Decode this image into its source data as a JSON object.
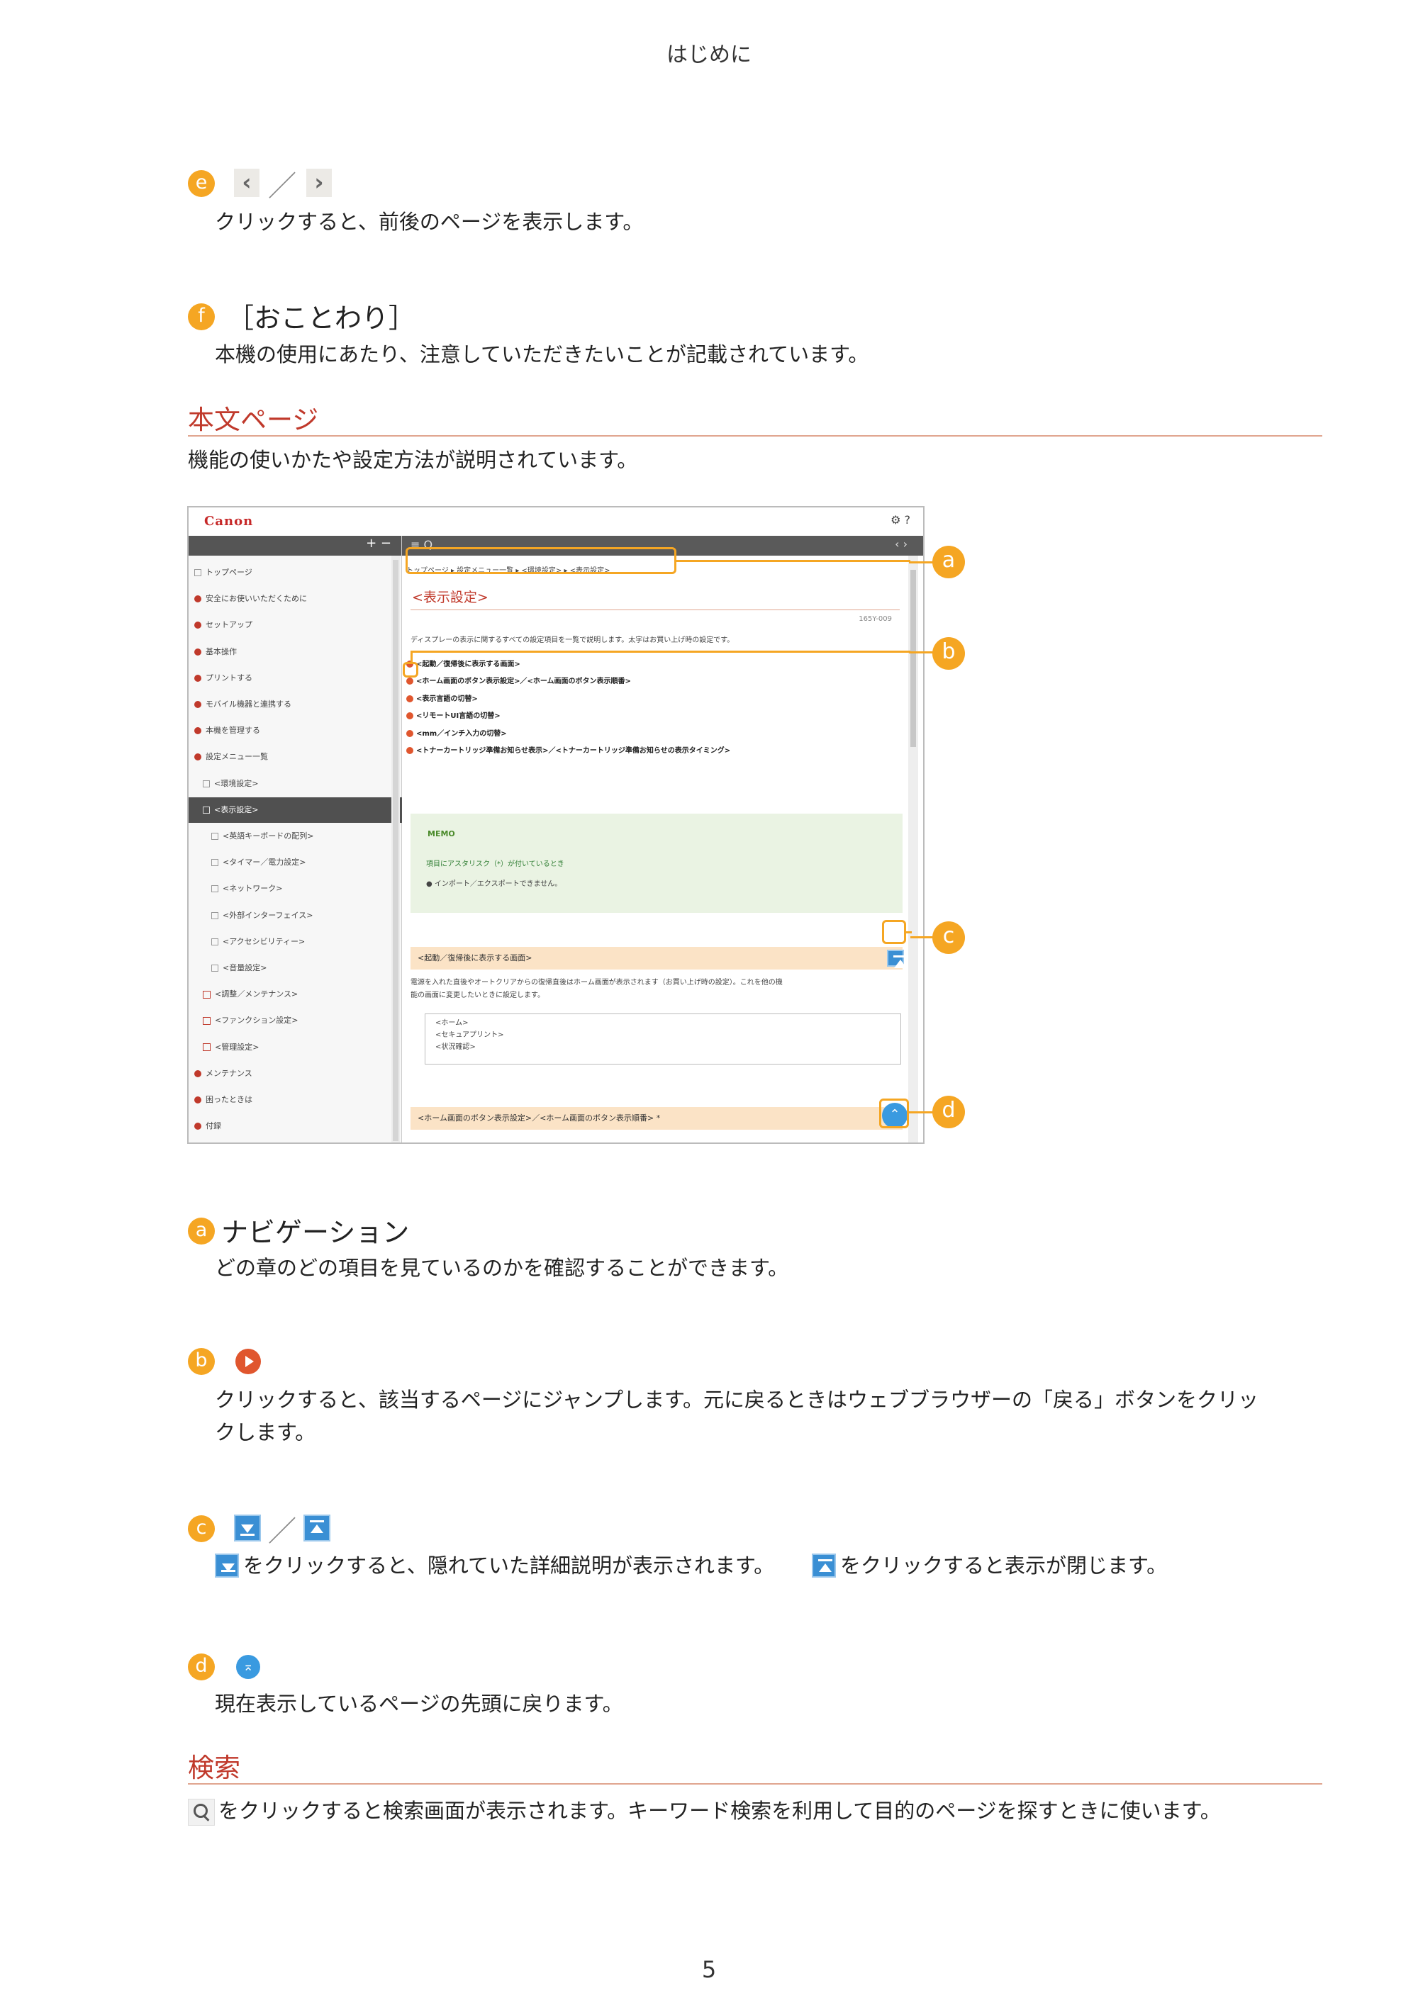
{
  "header": {
    "title": "はじめに"
  },
  "item_e": {
    "badge": "e",
    "prev_arrow": "‹",
    "separator": "／",
    "next_arrow": "›",
    "text": "クリックすると、前後のページを表示します。"
  },
  "item_f": {
    "badge": "f",
    "title": "［おことわり］",
    "text": "本機の使用にあたり、注意していただきたいことが記載されています。"
  },
  "section_body": {
    "heading": "本文ページ",
    "text": "機能の使いかたや設定方法が説明されています。"
  },
  "screenshot": {
    "logo": "Canon",
    "top_icons": "⚙ ?",
    "sidebar_controls": "+ −",
    "toolbar_left": "≡ Q",
    "toolbar_right": "‹ ›",
    "sidebar_items": [
      {
        "label": "トップページ",
        "kind": "square"
      },
      {
        "label": "安全にお使いいただくために",
        "kind": "dot"
      },
      {
        "label": "セットアップ",
        "kind": "dot"
      },
      {
        "label": "基本操作",
        "kind": "dot"
      },
      {
        "label": "プリントする",
        "kind": "dot"
      },
      {
        "label": "モバイル機器と連携する",
        "kind": "dot"
      },
      {
        "label": "本機を管理する",
        "kind": "dot"
      },
      {
        "label": "設定メニュー一覧",
        "kind": "dot"
      },
      {
        "label": "<環境設定>",
        "kind": "square",
        "indent": 1
      },
      {
        "label": "<表示設定>",
        "kind": "square",
        "indent": 1,
        "active": true
      },
      {
        "label": "<英語キーボードの配列>",
        "kind": "square",
        "indent": 2
      },
      {
        "label": "<タイマー／電力設定>",
        "kind": "square",
        "indent": 2
      },
      {
        "label": "<ネットワーク>",
        "kind": "square",
        "indent": 2
      },
      {
        "label": "<外部インターフェイス>",
        "kind": "square",
        "indent": 2
      },
      {
        "label": "<アクセシビリティー>",
        "kind": "square",
        "indent": 2
      },
      {
        "label": "<音量設定>",
        "kind": "square",
        "indent": 2
      },
      {
        "label": "<調整／メンテナンス>",
        "kind": "plus",
        "indent": 1
      },
      {
        "label": "<ファンクション設定>",
        "kind": "plus",
        "indent": 1
      },
      {
        "label": "<管理設定>",
        "kind": "plus",
        "indent": 1
      },
      {
        "label": "メンテナンス",
        "kind": "dot"
      },
      {
        "label": "困ったときは",
        "kind": "dot"
      },
      {
        "label": "付録",
        "kind": "dot"
      }
    ],
    "breadcrumb": "トップページ ▸ 設定メニュー一覧 ▸ <環境設定> ▸ <表示設定>",
    "pane_title": "<表示設定>",
    "doc_id": "165Y-009",
    "pane_desc": "ディスプレーの表示に関するすべての設定項目を一覧で説明します。太字はお買い上げ時の設定です。",
    "links": [
      "<起動／復帰後に表示する画面>",
      "<ホーム画面のボタン表示設定>／<ホーム画面のボタン表示順番>",
      "<表示言語の切替>",
      "<リモートUI言語の切替>",
      "<mm／インチ入力の切替>",
      "<トナーカートリッジ準備お知らせ表示>／<トナーカートリッジ準備お知らせの表示タイミング>"
    ],
    "memo_label": "MEMO",
    "memo_line1": "項目にアスタリスク（*）が付いているとき",
    "memo_line2": "● インポート／エクスポートできません。",
    "band1": "<起動／復帰後に表示する画面>",
    "band1_text1": "電源を入れた直後やオートクリアからの復帰直後はホーム画面が表示されます（お買い上げ時の設定）。これを他の機",
    "band1_text2": "能の画面に変更したいときに設定します。",
    "box_lines": [
      "<ホーム>",
      "<セキュアプリント>",
      "<状況確認>"
    ],
    "band2": "<ホーム画面のボタン表示設定>／<ホーム画面のボタン表示順番> *",
    "callouts": [
      "a",
      "b",
      "c",
      "d"
    ]
  },
  "item_a": {
    "badge": "a",
    "title": "ナビゲーション",
    "text": "どの章のどの項目を見ているのかを確認することができます。"
  },
  "item_b": {
    "badge": "b",
    "text_line1": "クリックすると、該当するページにジャンプします。元に戻るときはウェブブラウザーの「戻る」ボタンをクリッ",
    "text_line2": "クします。"
  },
  "item_c": {
    "badge": "c",
    "separator": "／",
    "text_part1": "をクリックすると、隠れていた詳細説明が表示されます。",
    "text_part2": "をクリックすると表示が閉じます。"
  },
  "item_d": {
    "badge": "d",
    "top_icon": "⌅",
    "text": "現在表示しているページの先頭に戻ります。"
  },
  "section_search": {
    "heading": "検索",
    "text": "をクリックすると検索画面が表示されます。キーワード検索を利用して目的のページを探すときに使います。"
  },
  "footer": {
    "page_number": "5"
  },
  "colors": {
    "badge": "#f5a623",
    "heading": "#c0392b",
    "rule": "#e0a58f",
    "link_icon": "#e0562e",
    "expand_icon": "#3a8fd4"
  }
}
